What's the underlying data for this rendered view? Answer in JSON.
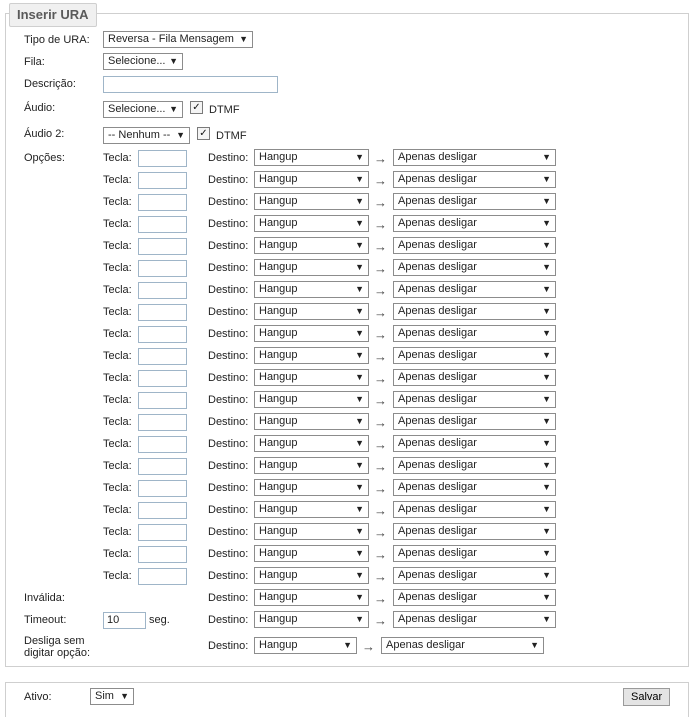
{
  "legend": "Inserir URA",
  "form": {
    "tipo_label": "Tipo de URA:",
    "tipo_value": "Reversa - Fila Mensagem",
    "fila_label": "Fila:",
    "fila_value": "Selecione...",
    "descricao_label": "Descrição:",
    "descricao_value": "",
    "audio_label": "Áudio:",
    "audio_value": "Selecione...",
    "audio_dtmf_label": "DTMF",
    "audio_dtmf_checked": true,
    "audio2_label": "Áudio 2:",
    "audio2_value": "-- Nenhum --",
    "audio2_dtmf_label": "DTMF",
    "audio2_dtmf_checked": true,
    "opcoes_label": "Opções:"
  },
  "option_rows": [
    {
      "tecla_label": "Tecla:",
      "tecla_value": "",
      "destino_label": "Destino:",
      "destino_value": "Hangup",
      "arrow": "→",
      "target_value": "Apenas desligar"
    },
    {
      "tecla_label": "Tecla:",
      "tecla_value": "",
      "destino_label": "Destino:",
      "destino_value": "Hangup",
      "arrow": "→",
      "target_value": "Apenas desligar"
    },
    {
      "tecla_label": "Tecla:",
      "tecla_value": "",
      "destino_label": "Destino:",
      "destino_value": "Hangup",
      "arrow": "→",
      "target_value": "Apenas desligar"
    },
    {
      "tecla_label": "Tecla:",
      "tecla_value": "",
      "destino_label": "Destino:",
      "destino_value": "Hangup",
      "arrow": "→",
      "target_value": "Apenas desligar"
    },
    {
      "tecla_label": "Tecla:",
      "tecla_value": "",
      "destino_label": "Destino:",
      "destino_value": "Hangup",
      "arrow": "→",
      "target_value": "Apenas desligar"
    },
    {
      "tecla_label": "Tecla:",
      "tecla_value": "",
      "destino_label": "Destino:",
      "destino_value": "Hangup",
      "arrow": "→",
      "target_value": "Apenas desligar"
    },
    {
      "tecla_label": "Tecla:",
      "tecla_value": "",
      "destino_label": "Destino:",
      "destino_value": "Hangup",
      "arrow": "→",
      "target_value": "Apenas desligar"
    },
    {
      "tecla_label": "Tecla:",
      "tecla_value": "",
      "destino_label": "Destino:",
      "destino_value": "Hangup",
      "arrow": "→",
      "target_value": "Apenas desligar"
    },
    {
      "tecla_label": "Tecla:",
      "tecla_value": "",
      "destino_label": "Destino:",
      "destino_value": "Hangup",
      "arrow": "→",
      "target_value": "Apenas desligar"
    },
    {
      "tecla_label": "Tecla:",
      "tecla_value": "",
      "destino_label": "Destino:",
      "destino_value": "Hangup",
      "arrow": "→",
      "target_value": "Apenas desligar"
    },
    {
      "tecla_label": "Tecla:",
      "tecla_value": "",
      "destino_label": "Destino:",
      "destino_value": "Hangup",
      "arrow": "→",
      "target_value": "Apenas desligar"
    },
    {
      "tecla_label": "Tecla:",
      "tecla_value": "",
      "destino_label": "Destino:",
      "destino_value": "Hangup",
      "arrow": "→",
      "target_value": "Apenas desligar"
    },
    {
      "tecla_label": "Tecla:",
      "tecla_value": "",
      "destino_label": "Destino:",
      "destino_value": "Hangup",
      "arrow": "→",
      "target_value": "Apenas desligar"
    },
    {
      "tecla_label": "Tecla:",
      "tecla_value": "",
      "destino_label": "Destino:",
      "destino_value": "Hangup",
      "arrow": "→",
      "target_value": "Apenas desligar"
    },
    {
      "tecla_label": "Tecla:",
      "tecla_value": "",
      "destino_label": "Destino:",
      "destino_value": "Hangup",
      "arrow": "→",
      "target_value": "Apenas desligar"
    },
    {
      "tecla_label": "Tecla:",
      "tecla_value": "",
      "destino_label": "Destino:",
      "destino_value": "Hangup",
      "arrow": "→",
      "target_value": "Apenas desligar"
    },
    {
      "tecla_label": "Tecla:",
      "tecla_value": "",
      "destino_label": "Destino:",
      "destino_value": "Hangup",
      "arrow": "→",
      "target_value": "Apenas desligar"
    },
    {
      "tecla_label": "Tecla:",
      "tecla_value": "",
      "destino_label": "Destino:",
      "destino_value": "Hangup",
      "arrow": "→",
      "target_value": "Apenas desligar"
    },
    {
      "tecla_label": "Tecla:",
      "tecla_value": "",
      "destino_label": "Destino:",
      "destino_value": "Hangup",
      "arrow": "→",
      "target_value": "Apenas desligar"
    },
    {
      "tecla_label": "Tecla:",
      "tecla_value": "",
      "destino_label": "Destino:",
      "destino_value": "Hangup",
      "arrow": "→",
      "target_value": "Apenas desligar"
    }
  ],
  "invalida": {
    "label": "Inválida:",
    "destino_label": "Destino:",
    "destino_value": "Hangup",
    "arrow": "→",
    "target_value": "Apenas desligar"
  },
  "timeout": {
    "label": "Timeout:",
    "value": "10",
    "unit": "seg.",
    "destino_label": "Destino:",
    "destino_value": "Hangup",
    "arrow": "→",
    "target_value": "Apenas desligar"
  },
  "desliga": {
    "label_line1": "Desliga sem",
    "label_line2": "digitar opção:",
    "destino_label": "Destino:",
    "destino_value": "Hangup",
    "arrow": "→",
    "target_value": "Apenas desligar"
  },
  "footer": {
    "ativo_label": "Ativo:",
    "ativo_value": "Sim",
    "salvar_label": "Salvar"
  },
  "icons": {
    "dropdown": "▼",
    "check": "✓"
  }
}
